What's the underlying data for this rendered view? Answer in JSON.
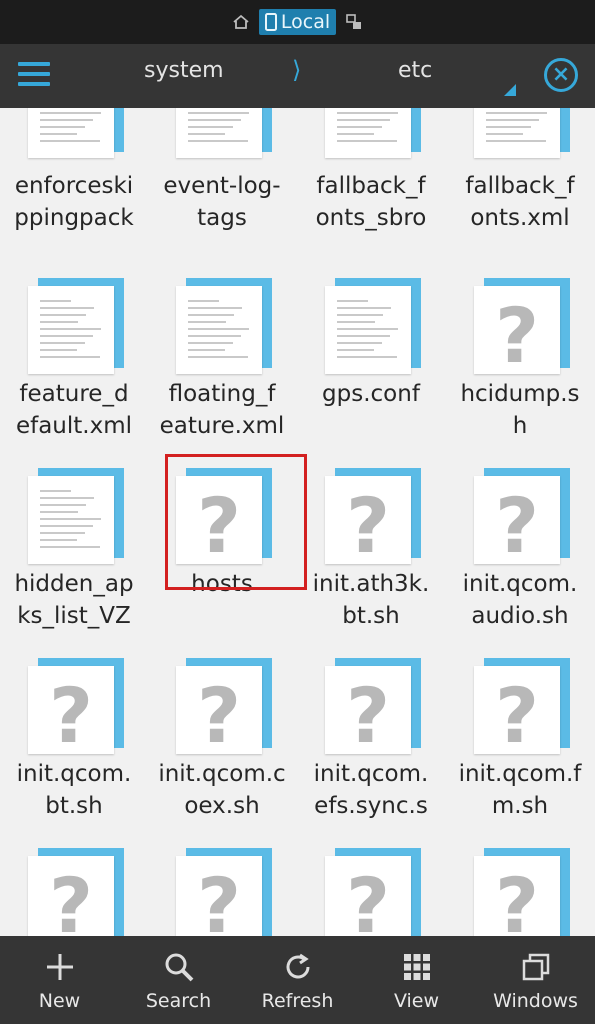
{
  "location_bar": {
    "selected_label": "Local"
  },
  "header": {
    "breadcrumb": [
      "system",
      "etc"
    ],
    "separator": "⟩"
  },
  "files": [
    {
      "name": "enforceski\nppingpack",
      "type": "text"
    },
    {
      "name": "event-log-\ntags",
      "type": "text"
    },
    {
      "name": "fallback_f\nonts_sbro",
      "type": "text"
    },
    {
      "name": "fallback_f\nonts.xml",
      "type": "text"
    },
    {
      "name": "feature_d\nefault.xml",
      "type": "text"
    },
    {
      "name": "floating_f\neature.xml",
      "type": "text"
    },
    {
      "name": "gps.conf",
      "type": "text"
    },
    {
      "name": "hcidump.s\nh",
      "type": "unknown"
    },
    {
      "name": "hidden_ap\nks_list_VZ",
      "type": "text"
    },
    {
      "name": "hosts",
      "type": "unknown",
      "selected": true
    },
    {
      "name": "init.ath3k.\nbt.sh",
      "type": "unknown"
    },
    {
      "name": "init.qcom.\naudio.sh",
      "type": "unknown"
    },
    {
      "name": "init.qcom.\nbt.sh",
      "type": "unknown"
    },
    {
      "name": "init.qcom.c\noex.sh",
      "type": "unknown"
    },
    {
      "name": "init.qcom.\nefs.sync.s",
      "type": "unknown"
    },
    {
      "name": "init.qcom.f\nm.sh",
      "type": "unknown"
    },
    {
      "name": "",
      "type": "unknown"
    },
    {
      "name": "",
      "type": "unknown"
    },
    {
      "name": "",
      "type": "unknown"
    },
    {
      "name": "",
      "type": "unknown"
    }
  ],
  "toolbar": {
    "items": [
      {
        "label": "New",
        "icon": "plus-icon"
      },
      {
        "label": "Search",
        "icon": "search-icon"
      },
      {
        "label": "Refresh",
        "icon": "refresh-icon"
      },
      {
        "label": "View",
        "icon": "grid-view-icon"
      },
      {
        "label": "Windows",
        "icon": "windows-icon"
      }
    ]
  },
  "colors": {
    "accent": "#36a8d9",
    "selection_outline": "#d32020",
    "bar_background": "#353535"
  }
}
